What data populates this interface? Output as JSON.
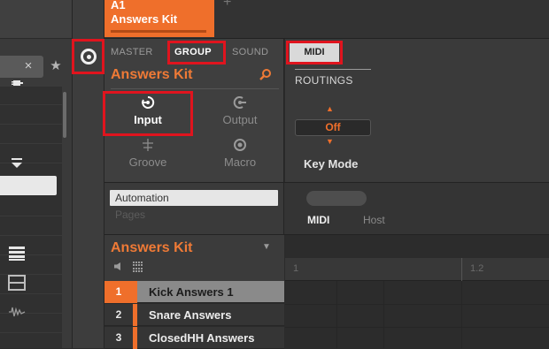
{
  "group_tab": {
    "id": "A1",
    "name": "Answers Kit"
  },
  "control": {
    "scope_tabs": {
      "master": "MASTER",
      "group": "GROUP",
      "sound": "SOUND"
    },
    "title": "Answers Kit",
    "pages": {
      "input": "Input",
      "output": "Output",
      "groove": "Groove",
      "macro": "Macro"
    },
    "midi_tab": "MIDI",
    "routings_label": "ROUTINGS",
    "key_mode": {
      "value": "Off",
      "label": "Key Mode"
    }
  },
  "automation": {
    "button": "Automation",
    "pages_label": "Pages",
    "tabs": {
      "midi": "MIDI",
      "host": "Host"
    }
  },
  "sound_list": {
    "title": "Answers Kit",
    "rows": [
      {
        "num": "1",
        "name": "Kick Answers 1"
      },
      {
        "num": "2",
        "name": "Snare Answers"
      },
      {
        "num": "3",
        "name": "ClosedHH Answers"
      }
    ]
  },
  "ruler": {
    "mark1": "1",
    "mark2": "1.2"
  },
  "browser": {
    "clear": "×",
    "favorite": "★"
  },
  "colors": {
    "accent": "#ef6f2b",
    "highlight": "#e0141e"
  }
}
